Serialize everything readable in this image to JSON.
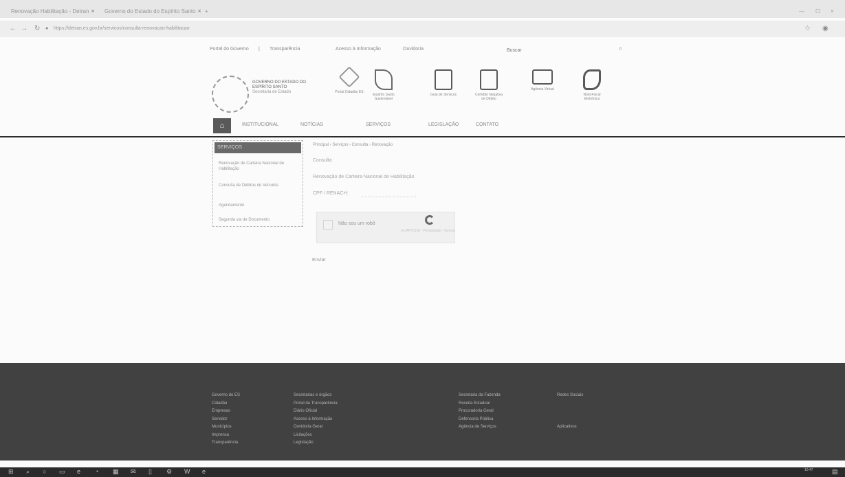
{
  "browser": {
    "tabs": [
      {
        "title": "Renovação Habilitação - Detran"
      },
      {
        "title": "Governo do Estado do Espírito Santo"
      }
    ],
    "new_tab": "+",
    "url": "https://detran.es.gov.br/servicos/consulta-renovacao-habilitacao"
  },
  "top_links": [
    "Portal do Governo",
    "Transparência",
    "Acesso à Informação",
    "Ouvidoria"
  ],
  "search": {
    "placeholder": "Buscar"
  },
  "header": {
    "gov_name": "GOVERNO DO ESTADO DO ESPÍRITO SANTO",
    "gov_sub": "Secretaria de Estado",
    "icons": [
      {
        "label": "Portal Cidadão ES",
        "icon": "es-logo-icon"
      },
      {
        "label": "Espírito Santo Sustentável",
        "icon": "leaf-icon"
      },
      {
        "label": "Guia de Serviços",
        "icon": "scan-icon"
      },
      {
        "label": "Certidão Negativa de Débito",
        "icon": "document-icon"
      },
      {
        "label": "Agência Virtual",
        "icon": "laptop-icon"
      },
      {
        "label": "Nota Fiscal Eletrônica",
        "icon": "map-icon"
      }
    ]
  },
  "nav": {
    "home": "⌂",
    "items": [
      "INSTITUCIONAL",
      "NOTÍCIAS",
      "SERVIÇOS",
      "LEGISLAÇÃO",
      "CONTATO"
    ]
  },
  "sidebar": {
    "title": "SERVIÇOS",
    "items": [
      "Renovação de Carteira Nacional de Habilitação",
      "Consulta de Débitos de Veículos",
      "Agendamento",
      "Segunda via de Documento"
    ]
  },
  "content": {
    "breadcrumb": "Principal  ›  Serviços  ›  Consulta  ›  Renovação",
    "heading": "Consulta",
    "subtitle": "Renovação de Carteira Nacional de Habilitação",
    "field_label": "CPF / RENACH:",
    "captcha_label": "Não sou um robô",
    "captcha_brand": "reCAPTCHA · Privacidade - Termos",
    "submit": "Enviar"
  },
  "footer": {
    "col1": [
      "Governo do ES",
      "Cidadão",
      "Empresas",
      "Servidor",
      "Municípios",
      "Imprensa",
      "Transparência"
    ],
    "col2": [
      "Secretarias e órgãos",
      "Portal da Transparência",
      "Diário Oficial",
      "Acesso à Informação",
      "Ouvidoria Geral",
      "Licitações",
      "Legislação"
    ],
    "col3": [
      "Secretaria da Fazenda",
      "Receita Estadual",
      "Procuradoria Geral",
      "Defensoria Pública",
      "Agência de Serviços"
    ],
    "col4": [
      "Redes Sociais",
      "",
      "",
      "",
      "Aplicativos"
    ]
  },
  "taskbar": {
    "icons": [
      "windows-icon",
      "search-icon",
      "cortana-icon",
      "task-view-icon",
      "edge-icon",
      "chrome-icon",
      "store-icon",
      "mail-icon",
      "file-icon",
      "settings-icon",
      "word-icon",
      "edge-icon"
    ],
    "clock": "10:47"
  }
}
